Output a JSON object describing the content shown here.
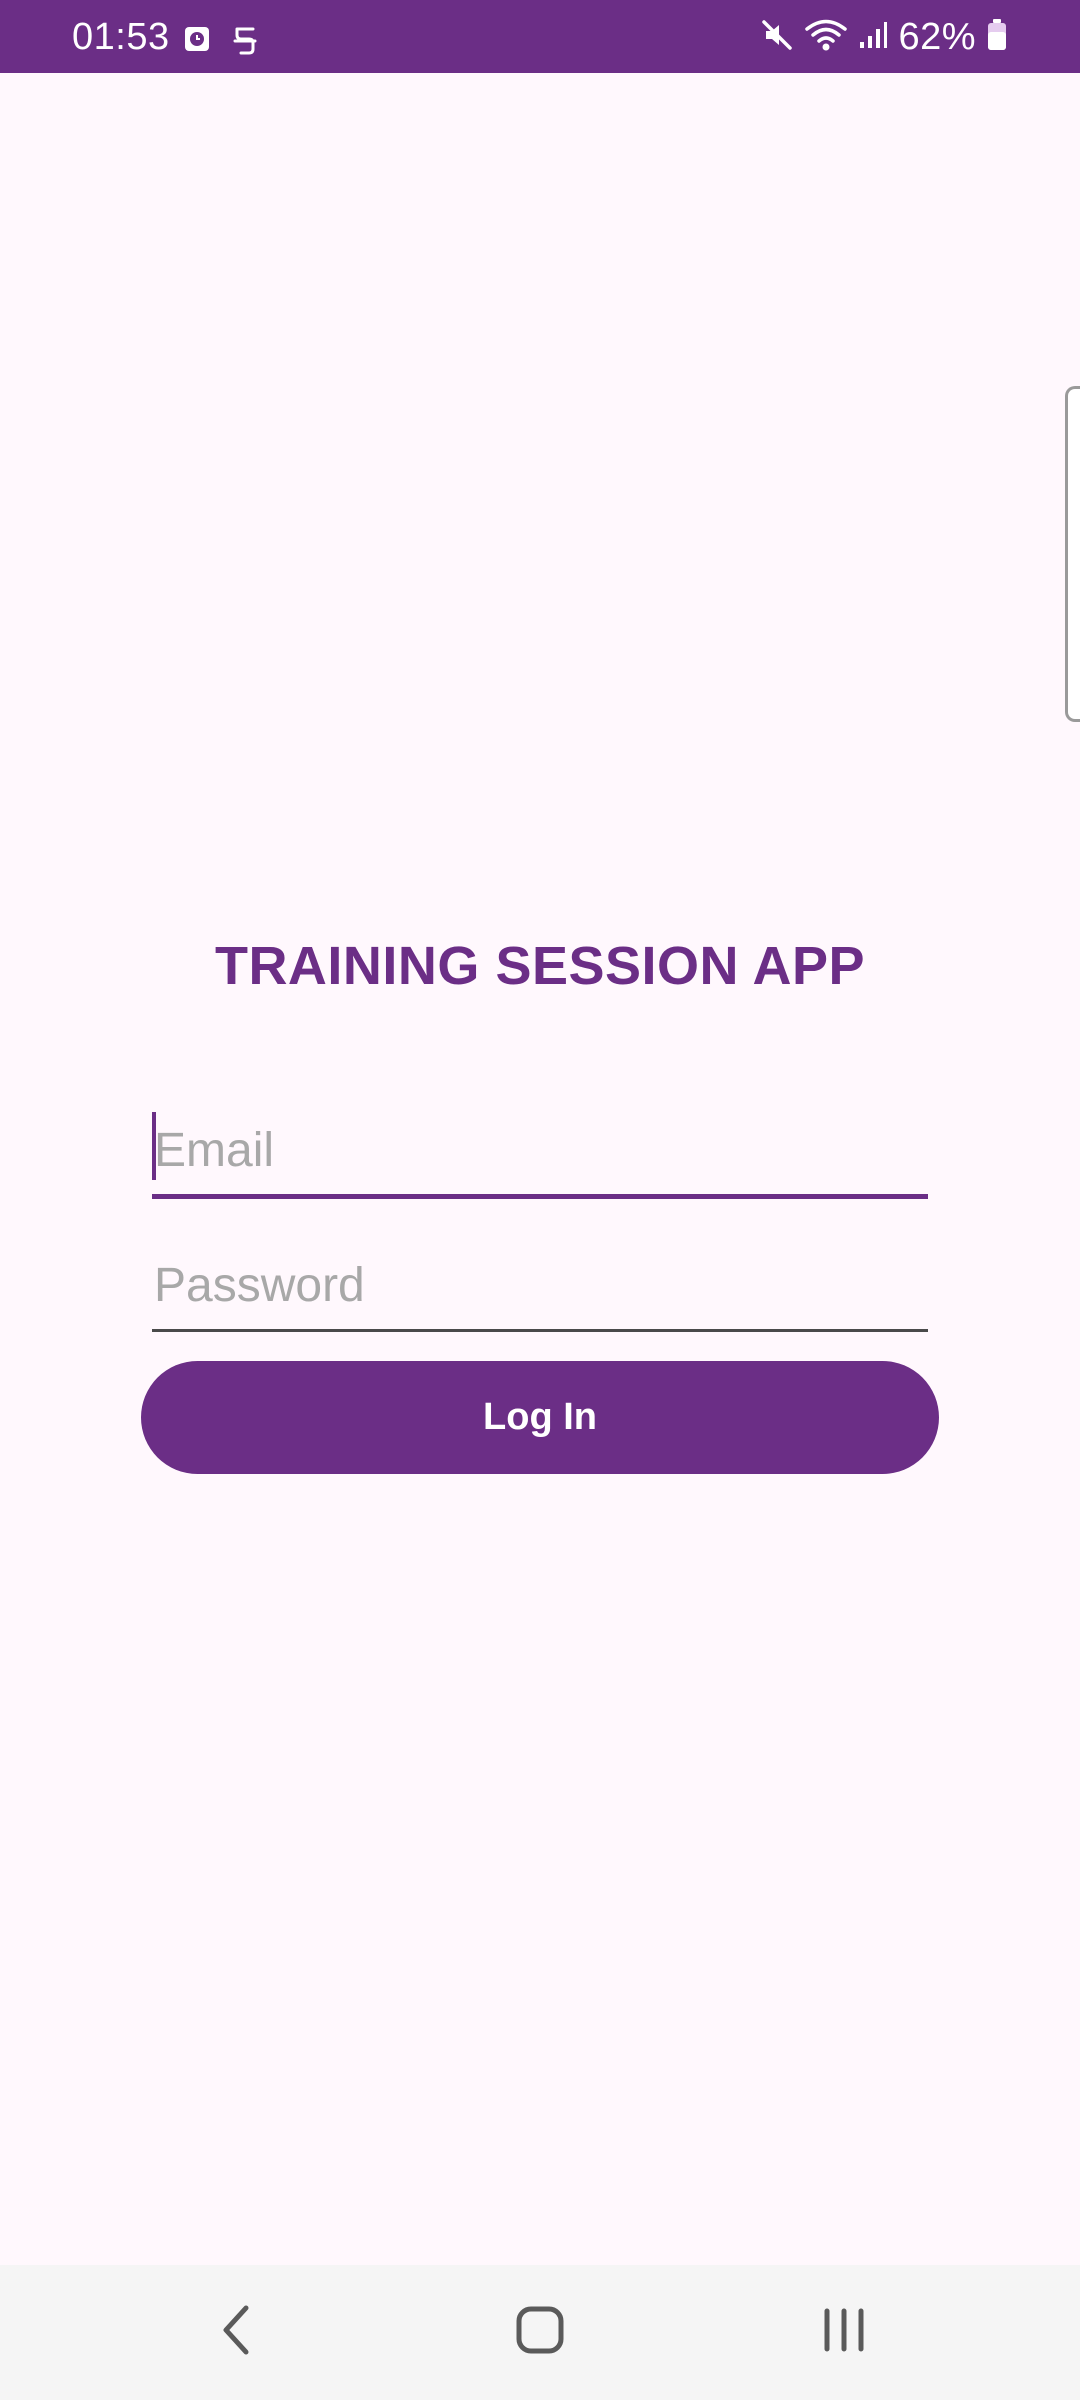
{
  "status_bar": {
    "time": "01:53",
    "battery": "62%",
    "icons": [
      "clock-notification-icon",
      "accessibility-icon",
      "mute-icon",
      "wifi-icon",
      "signal-icon",
      "battery-icon"
    ],
    "background_color": "#6B2E86"
  },
  "login": {
    "title": "TRAINING SESSION APP",
    "email_placeholder": "Email",
    "email_value": "",
    "password_placeholder": "Password",
    "password_value": "",
    "button_label": "Log In"
  },
  "nav": {
    "icons": [
      "back-icon",
      "home-icon",
      "recents-icon"
    ]
  },
  "colors": {
    "accent": "#6B2E86",
    "background": "#FFF8FD",
    "placeholder": "#A8A8A8",
    "nav_background": "#F5F5F5"
  }
}
